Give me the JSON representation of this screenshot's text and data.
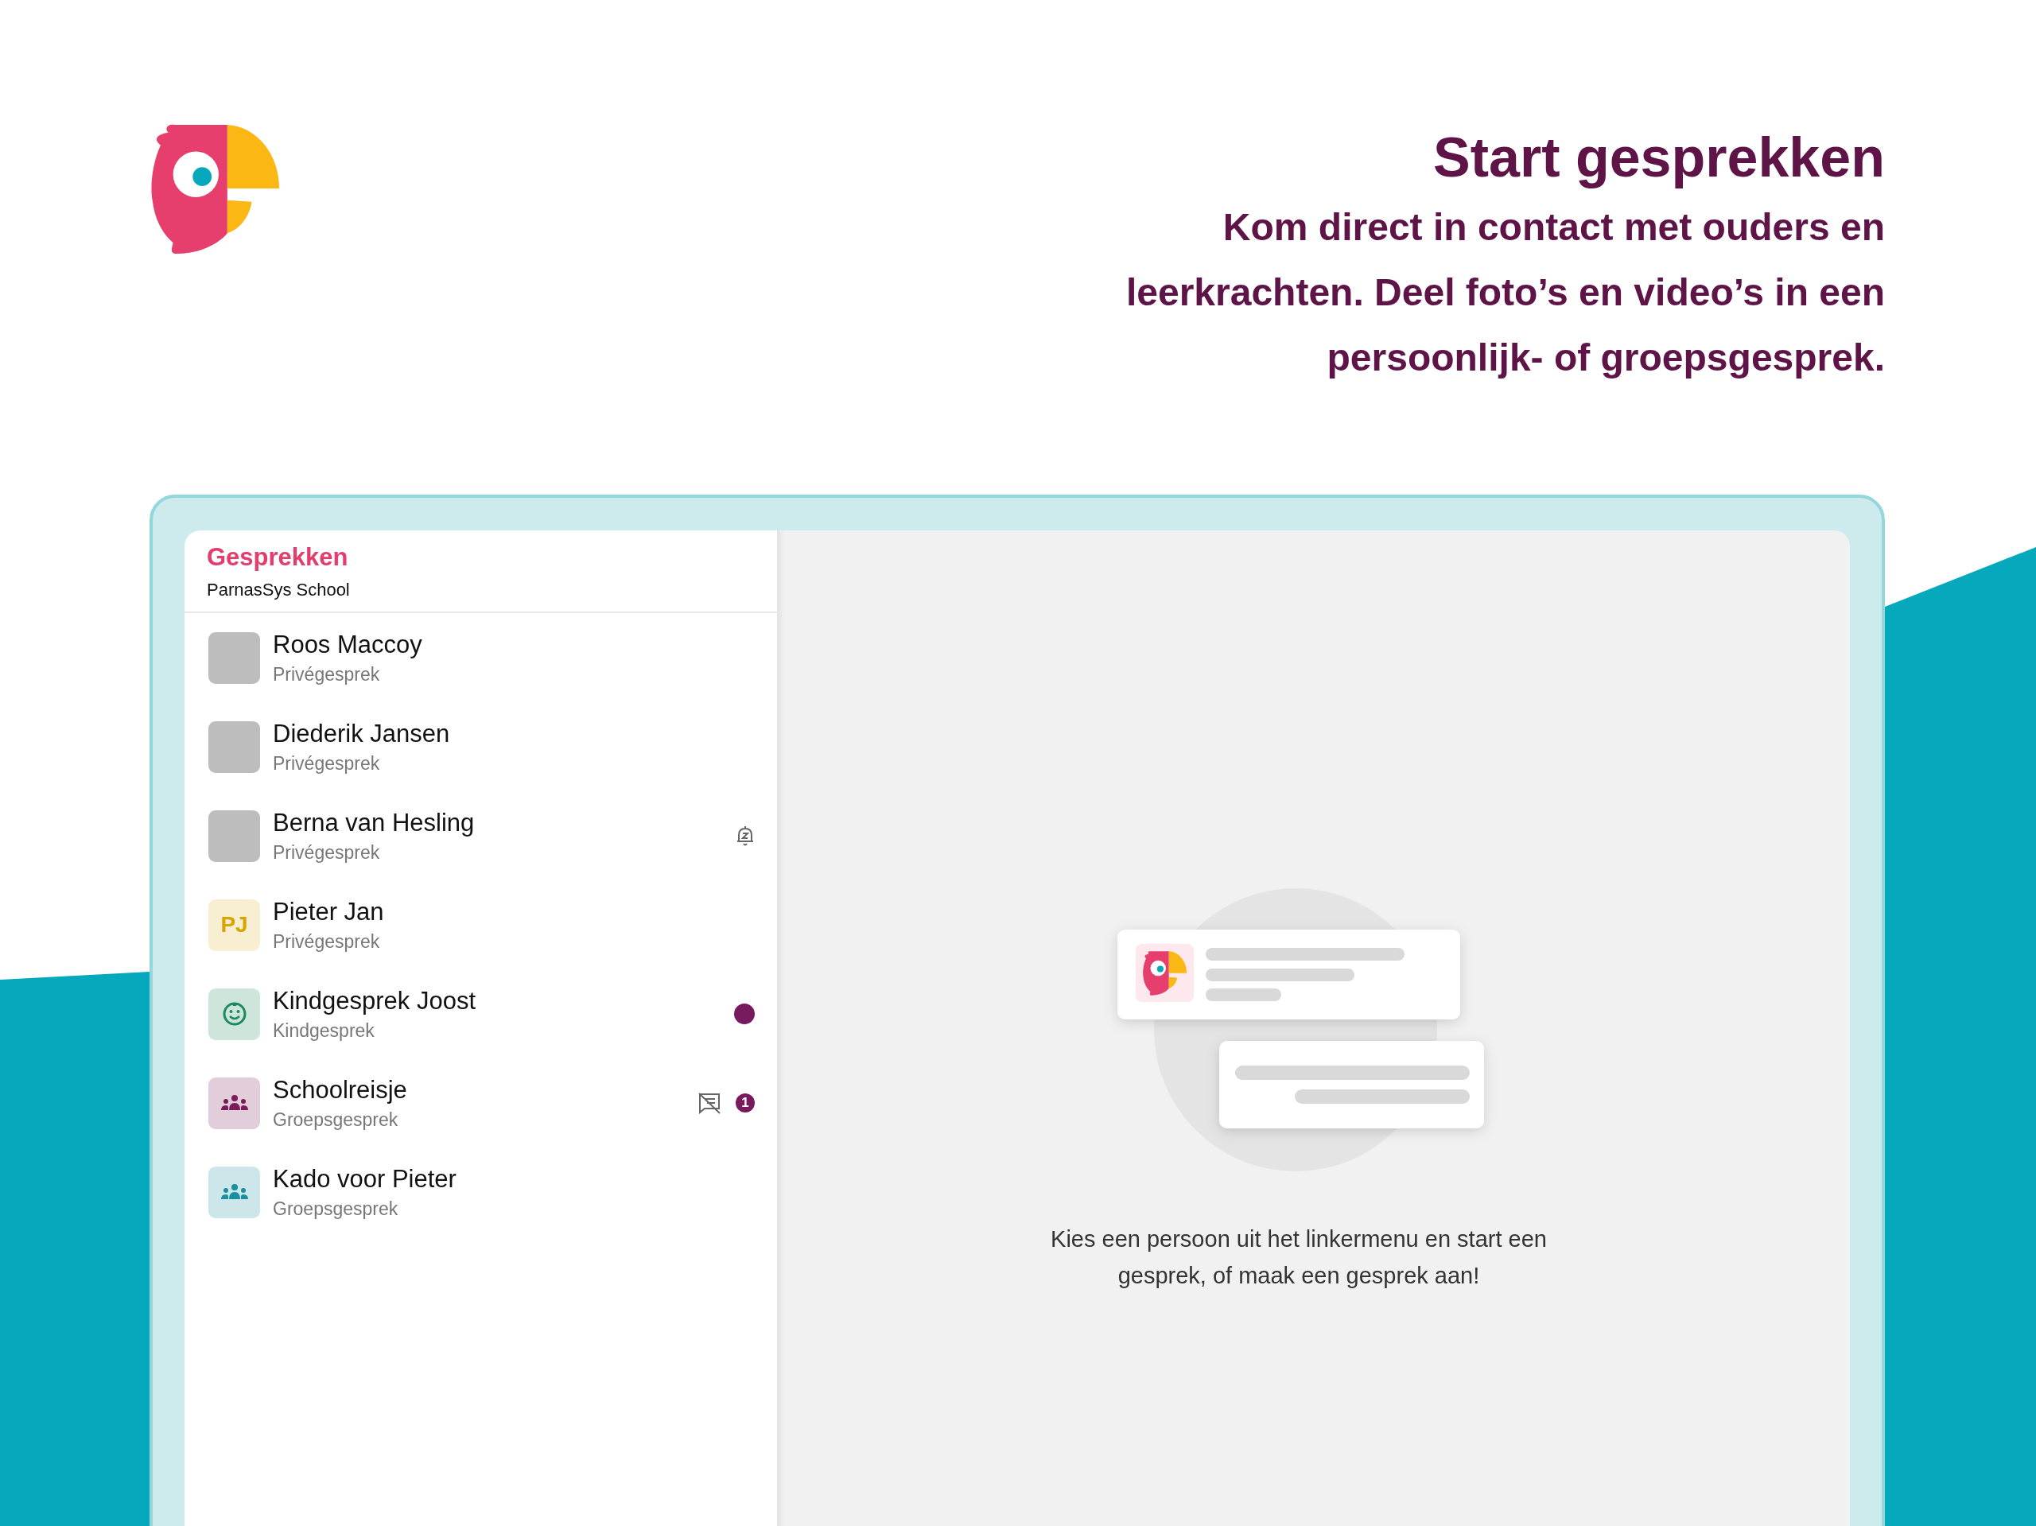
{
  "heading": {
    "title": "Start gesprekken",
    "subtitle": "Kom direct in contact met ouders en\nleerkrachten. Deel foto’s en video’s in een\npersoonlijk- of groepsgesprek."
  },
  "sidebar": {
    "title": "Gesprekken",
    "subtitle": "ParnasSys School"
  },
  "conversations": [
    {
      "name": "Roos Maccoy",
      "type": "Privégesprek",
      "avatar": {
        "kind": "photo"
      },
      "muted": false,
      "unread": false,
      "chat_disabled": false
    },
    {
      "name": "Diederik Jansen",
      "type": "Privégesprek",
      "avatar": {
        "kind": "photo"
      },
      "muted": false,
      "unread": false,
      "chat_disabled": false
    },
    {
      "name": "Berna van Hesling",
      "type": "Privégesprek",
      "avatar": {
        "kind": "photo"
      },
      "muted": true,
      "unread": false,
      "chat_disabled": false
    },
    {
      "name": "Pieter Jan",
      "type": "Privégesprek",
      "avatar": {
        "kind": "initials",
        "initials": "PJ",
        "color": "#d9a300"
      },
      "muted": false,
      "unread": false,
      "chat_disabled": false
    },
    {
      "name": "Kindgesprek Joost",
      "type": "Kindgesprek",
      "avatar": {
        "kind": "child",
        "color": "#1c8a5c"
      },
      "muted": false,
      "unread": true,
      "chat_disabled": false
    },
    {
      "name": "Schoolreisje",
      "type": "Groepsgesprek",
      "avatar": {
        "kind": "group",
        "color": "#7b1d5a"
      },
      "muted": false,
      "unread": false,
      "chat_disabled": true,
      "unread_count": "1"
    },
    {
      "name": "Kado voor Pieter",
      "type": "Groepsgesprek",
      "avatar": {
        "kind": "group",
        "color": "#1a8fa0"
      },
      "muted": false,
      "unread": false,
      "chat_disabled": false
    }
  ],
  "empty_state": {
    "message": "Kies een persoon uit het linkermenu en start een\ngesprek, of maak een gesprek aan!"
  }
}
